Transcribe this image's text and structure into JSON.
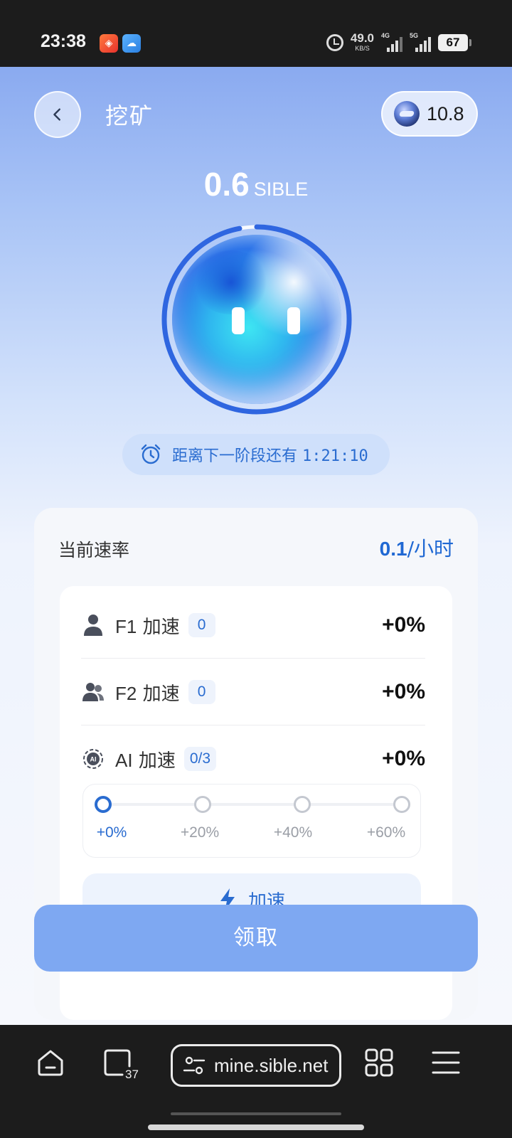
{
  "status_bar": {
    "time": "23:38",
    "net_speed": "49.0",
    "net_speed_unit": "KB/S",
    "sim1_label": "4G",
    "sim2_label": "5G",
    "battery": "67"
  },
  "header": {
    "back_icon": "chevron-left-icon",
    "title": "挖矿",
    "balance_icon": "coin-icon",
    "balance": "10.8"
  },
  "mining": {
    "amount": "0.6",
    "unit": "SIBLE",
    "progress_ring_fraction": 0.97,
    "countdown_label": "距离下一阶段还有",
    "countdown_time": "1:21:10"
  },
  "rate": {
    "label": "当前速率",
    "value": "0.1",
    "unit": "/小时"
  },
  "boosts": [
    {
      "icon": "user-icon",
      "name_latin": "F1",
      "name_cjk": "加速",
      "badge": "0",
      "percent": "+0%"
    },
    {
      "icon": "users-icon",
      "name_latin": "F2",
      "name_cjk": "加速",
      "badge": "0",
      "percent": "+0%"
    },
    {
      "icon": "ai-chip-icon",
      "name_latin": "AI",
      "name_cjk": "加速",
      "badge": "0/3",
      "percent": "+0%"
    }
  ],
  "ai_levels": {
    "active_index": 0,
    "ticks": [
      "+0%",
      "+20%",
      "+40%",
      "+60%"
    ]
  },
  "accelerate_button": "加速",
  "claim_button": "领取",
  "browser": {
    "tab_count": "37",
    "url": "mine.sible.net"
  },
  "colors": {
    "accent": "#2a6cd0",
    "claim_button_bg": "#7ea8f2"
  }
}
